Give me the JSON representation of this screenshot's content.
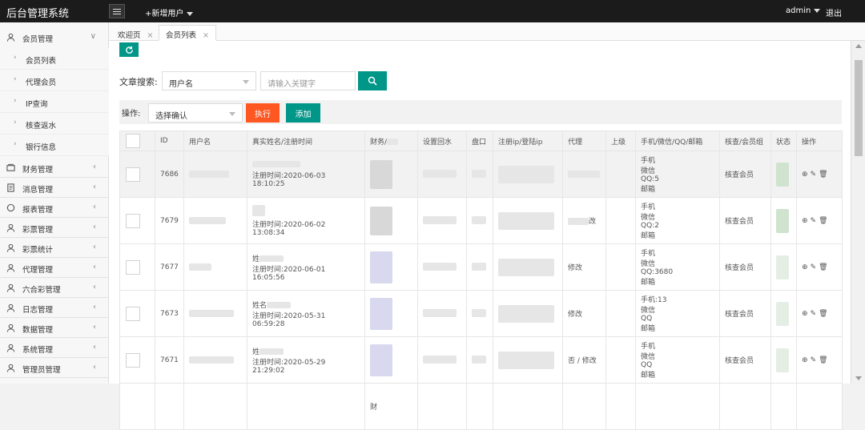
{
  "app": {
    "title": "后台管理系统"
  },
  "topbar": {
    "add_user": "+新增用户",
    "admin": "admin",
    "logout": "退出"
  },
  "sidebar": {
    "expanded": {
      "label": "会员管理",
      "children": [
        "会员列表",
        "代理会员",
        "IP查询",
        "核查返水",
        "银行信息"
      ]
    },
    "items": [
      "财务管理",
      "消息管理",
      "报表管理",
      "彩票管理",
      "彩票统计",
      "代理管理",
      "六合彩管理",
      "日志管理",
      "数据管理",
      "系统管理",
      "管理员管理"
    ]
  },
  "tabs": [
    {
      "label": "欢迎页"
    },
    {
      "label": "会员列表"
    }
  ],
  "search": {
    "label": "文章搜索:",
    "field_value": "用户名",
    "placeholder": "请输入关键字"
  },
  "operation": {
    "label": "操作:",
    "select_value": "选择确认",
    "exec": "执行",
    "add": "添加"
  },
  "table": {
    "headers": [
      "",
      "ID",
      "用户名",
      "真实姓名/注册时间",
      "财务/",
      "设置回水",
      "盘口",
      "注册ip/登陆ip",
      "代理",
      "上级",
      "手机/微信/QQ/邮箱",
      "核查/会员组",
      "状态",
      "操作"
    ],
    "rows": [
      {
        "id": "7686",
        "name_prefix": "",
        "reg": "注册时间:2020-06-03 18:10:25",
        "agent": "",
        "contact": [
          "手机",
          "微信",
          "QQ:5",
          "邮箱"
        ],
        "group": "核查会员"
      },
      {
        "id": "7679",
        "name_prefix": "",
        "reg": "注册时间:2020-06-02 13:08:34",
        "agent": "改",
        "contact": [
          "手机",
          "微信",
          "QQ:2",
          "邮箱"
        ],
        "group": "核查会员"
      },
      {
        "id": "7677",
        "name_prefix": "姓",
        "reg": "注册时间:2020-06-01 16:05:56",
        "agent": "修改",
        "contact": [
          "手机",
          "微信",
          "QQ:3680",
          "邮箱"
        ],
        "group": "核查会员"
      },
      {
        "id": "7673",
        "name_prefix": "姓名",
        "reg": "注册时间:2020-05-31 06:59:28",
        "agent": "修改",
        "contact": [
          "手机:13",
          "微信",
          "QQ",
          "邮箱"
        ],
        "group": "核查会员"
      },
      {
        "id": "7671",
        "name_prefix": "姓",
        "reg": "注册时间:2020-05-29 21:29:02",
        "agent": "否 / 修改",
        "contact": [
          "手机",
          "微信",
          "QQ",
          "邮箱"
        ],
        "group": "核查会员"
      }
    ],
    "last_row_fin": "财"
  },
  "icons": {
    "refresh": "refresh-icon",
    "search": "search-icon",
    "download": "download-icon",
    "edit": "edit-icon",
    "delete": "trash-icon"
  },
  "colors": {
    "topbar": "#1b1b1b",
    "primary": "#009688",
    "danger": "#ff5722"
  }
}
